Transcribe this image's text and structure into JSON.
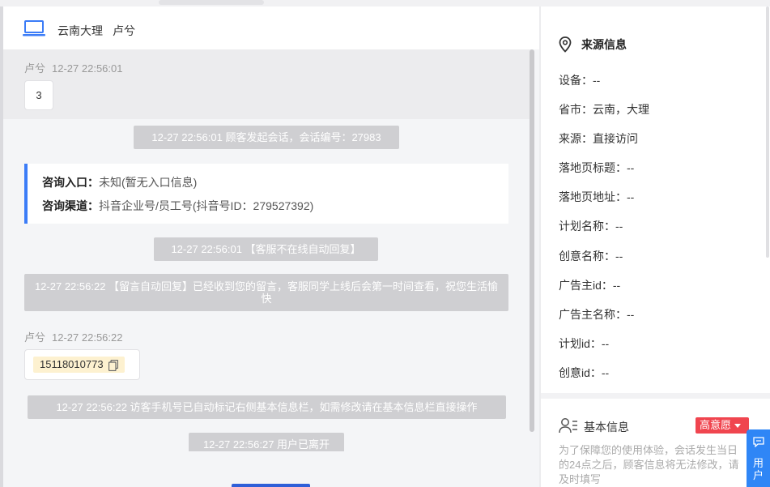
{
  "chat": {
    "header": {
      "region": "云南大理",
      "customer": "卢兮"
    },
    "messages": {
      "m1_sender": "卢兮",
      "m1_time": "12-27 22:56:01",
      "m1_text": "3",
      "sys1": "12-27 22:56:01 顾客发起会话，会话编号：27983",
      "entry_label": "咨询入口：",
      "entry_value": "未知(暂无入口信息)",
      "channel_label": "咨询渠道：",
      "channel_value": "抖音企业号/员工号(抖音号ID：279527392)",
      "sys2": "12-27 22:56:01 【客服不在线自动回复】",
      "sys3": "12-27 22:56:22 【留言自动回复】已经收到您的留言，客服同学上线后会第一时间查看，祝您生活愉快",
      "m2_sender": "卢兮",
      "m2_time": "12-27 22:56:22",
      "m2_phone": "15118010773",
      "sys4": "12-27 22:56:22 访客手机号已自动标记右侧基本信息栏，如需修改请在基本信息栏直接操作",
      "sys5": "12-27 22:56:27 用户已离开"
    }
  },
  "side": {
    "source_title": "来源信息",
    "device": "设备：--",
    "province": "省市：云南，大理",
    "source": "来源：直接访问",
    "landing_title": "落地页标题：--",
    "landing_url": "落地页地址：--",
    "plan_name": "计划名称：--",
    "creative_name": "创意名称：--",
    "advertiser_id": "广告主id：--",
    "advertiser_name": "广告主名称：--",
    "plan_id": "计划id：--",
    "creative_id": "创意id：--",
    "basic_title": "基本信息",
    "intent": "高意愿",
    "notice": "为了保障您的使用体验，会话发生当日的24点之后，顾客信息将无法修改，请及时填写"
  },
  "float_tab": {
    "label": "用户"
  },
  "colors": {
    "accent_blue": "#3b7cf7",
    "intent_red": "#f0454f",
    "system_gray": "#cfcfd2",
    "phone_highlight": "#fdf1d0"
  },
  "icons": [
    "laptop-icon",
    "copy-icon",
    "location-pin-icon",
    "user-list-icon",
    "chat-bubble-icon"
  ]
}
